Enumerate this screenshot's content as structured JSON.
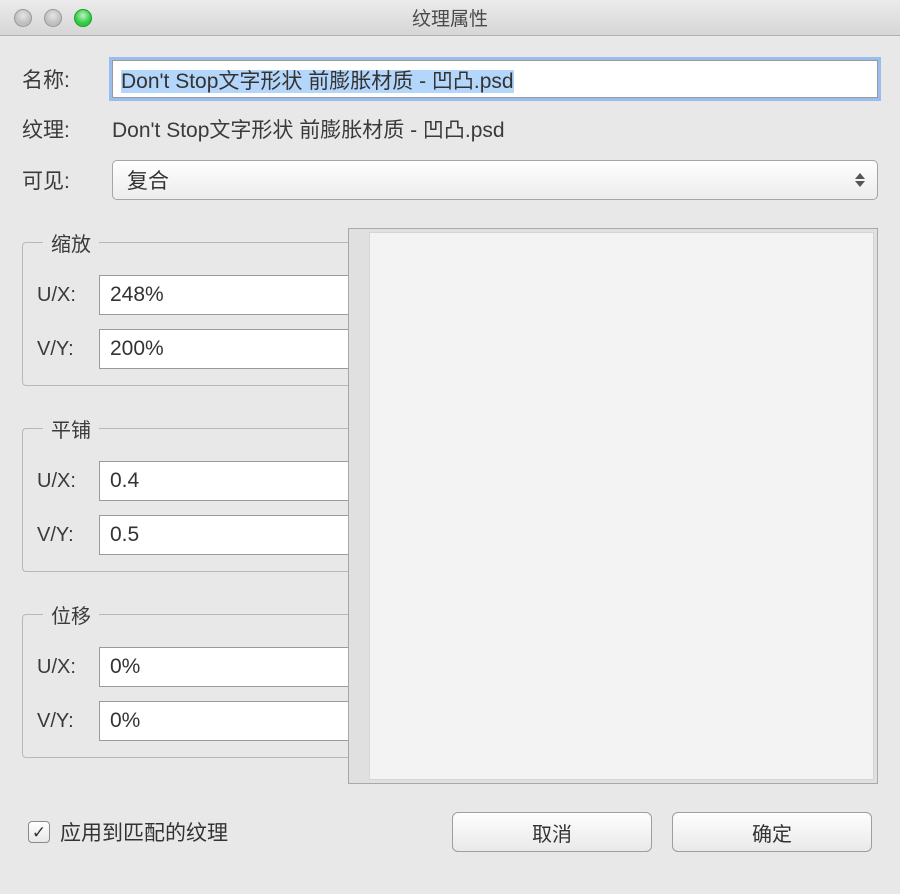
{
  "window": {
    "title": "纹理属性"
  },
  "labels": {
    "name": "名称:",
    "texture": "纹理:",
    "visible": "可见:"
  },
  "fields": {
    "name_value": "Don't Stop文字形状 前膨胀材质 - 凹凸.psd",
    "texture_value": "Don't Stop文字形状 前膨胀材质 - 凹凸.psd",
    "visible_value": "复合"
  },
  "groups": {
    "scale": {
      "title": "缩放",
      "ux_label": "U/X:",
      "ux_value": "248%",
      "vy_label": "V/Y:",
      "vy_value": "200%"
    },
    "tile": {
      "title": "平铺",
      "ux_label": "U/X:",
      "ux_value": "0.4",
      "vy_label": "V/Y:",
      "vy_value": "0.5"
    },
    "offset": {
      "title": "位移",
      "ux_label": "U/X:",
      "ux_value": "0%",
      "vy_label": "V/Y:",
      "vy_value": "0%"
    }
  },
  "footer": {
    "checkbox_label": "应用到匹配的纹理",
    "checkbox_checked": true,
    "cancel": "取消",
    "ok": "确定"
  }
}
